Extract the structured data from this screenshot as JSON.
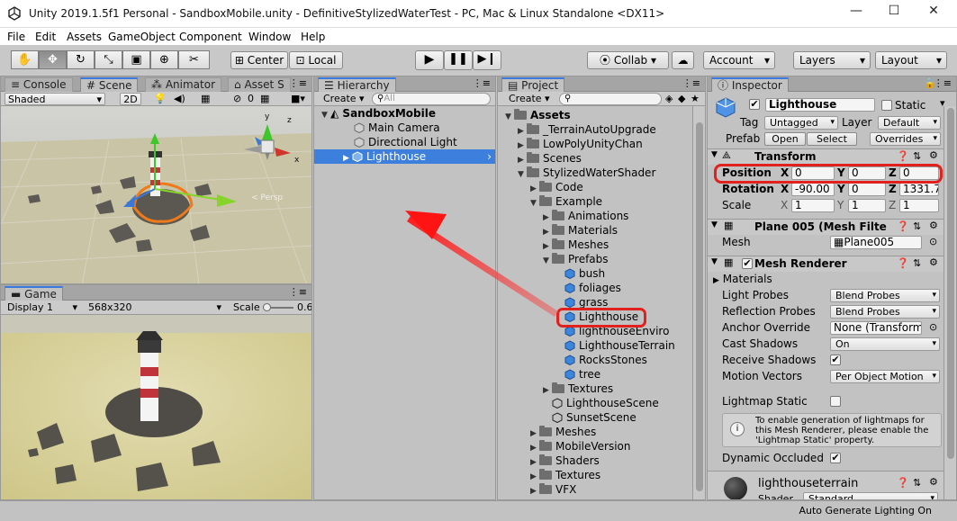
{
  "window": {
    "title": "Unity 2019.1.5f1 Personal - SandboxMobile.unity - DefinitiveStylizedWaterTest - PC, Mac & Linux Standalone <DX11>"
  },
  "menu": [
    "File",
    "Edit",
    "Assets",
    "GameObject",
    "Component",
    "Window",
    "Help"
  ],
  "toolbar": {
    "pivot": "Center",
    "space": "Local",
    "collab": "Collab ▾",
    "account": "Account",
    "layers": "Layers",
    "layout": "Layout"
  },
  "scene": {
    "tabs": [
      "Console",
      "Scene",
      "Animator",
      "Asset S"
    ],
    "shading": "Shaded",
    "mode2d": "2D",
    "hidden_count": "0",
    "gizmo_label": "< Persp"
  },
  "game": {
    "tab": "Game",
    "display": "Display 1",
    "resolution": "568x320",
    "scale_label": "Scale",
    "scale_value": "0.6"
  },
  "hierarchy": {
    "tab": "Hierarchy",
    "create": "Create ▾",
    "search_placeholder": "All",
    "scene": "SandboxMobile",
    "items": [
      "Main Camera",
      "Directional Light",
      "Lighthouse"
    ]
  },
  "project": {
    "tab": "Project",
    "create": "Create ▾",
    "tree": [
      {
        "label": "Assets",
        "depth": 0,
        "kind": "folder",
        "open": true,
        "bold": true
      },
      {
        "label": "_TerrainAutoUpgrade",
        "depth": 1,
        "kind": "folder"
      },
      {
        "label": "LowPolyUnityChan",
        "depth": 1,
        "kind": "folder"
      },
      {
        "label": "Scenes",
        "depth": 1,
        "kind": "folder"
      },
      {
        "label": "StylizedWaterShader",
        "depth": 1,
        "kind": "folder",
        "open": true
      },
      {
        "label": "Code",
        "depth": 2,
        "kind": "folder"
      },
      {
        "label": "Example",
        "depth": 2,
        "kind": "folder",
        "open": true
      },
      {
        "label": "Animations",
        "depth": 3,
        "kind": "folder"
      },
      {
        "label": "Materials",
        "depth": 3,
        "kind": "folder"
      },
      {
        "label": "Meshes",
        "depth": 3,
        "kind": "folder"
      },
      {
        "label": "Prefabs",
        "depth": 3,
        "kind": "folder",
        "open": true
      },
      {
        "label": "bush",
        "depth": 4,
        "kind": "prefab"
      },
      {
        "label": "foliages",
        "depth": 4,
        "kind": "prefab"
      },
      {
        "label": "grass",
        "depth": 4,
        "kind": "prefab"
      },
      {
        "label": "Lighthouse",
        "depth": 4,
        "kind": "prefab",
        "highlight": true
      },
      {
        "label": "lighthouseEnviro",
        "depth": 4,
        "kind": "prefab"
      },
      {
        "label": "LighthouseTerrain",
        "depth": 4,
        "kind": "prefab"
      },
      {
        "label": "RocksStones",
        "depth": 4,
        "kind": "prefab"
      },
      {
        "label": "tree",
        "depth": 4,
        "kind": "prefab"
      },
      {
        "label": "Textures",
        "depth": 3,
        "kind": "folder"
      },
      {
        "label": "LighthouseScene",
        "depth": 3,
        "kind": "scene"
      },
      {
        "label": "SunsetScene",
        "depth": 3,
        "kind": "scene"
      },
      {
        "label": "Meshes",
        "depth": 2,
        "kind": "folder"
      },
      {
        "label": "MobileVersion",
        "depth": 2,
        "kind": "folder"
      },
      {
        "label": "Shaders",
        "depth": 2,
        "kind": "folder"
      },
      {
        "label": "Textures",
        "depth": 2,
        "kind": "folder"
      },
      {
        "label": "VFX",
        "depth": 2,
        "kind": "folder"
      }
    ]
  },
  "inspector": {
    "tab": "Inspector",
    "object_name": "Lighthouse",
    "static_label": "Static",
    "tag_label": "Tag",
    "tag_value": "Untagged",
    "layer_label": "Layer",
    "layer_value": "Default",
    "prefab_label": "Prefab",
    "open": "Open",
    "select": "Select",
    "overrides": "Overrides",
    "transform": {
      "title": "Transform",
      "position_label": "Position",
      "rotation_label": "Rotation",
      "scale_label": "Scale",
      "position": [
        "0",
        "0",
        "0"
      ],
      "rotation": [
        "-90.00",
        "0",
        "1331.7"
      ],
      "scale": [
        "1",
        "1",
        "1"
      ],
      "axes": [
        "X",
        "Y",
        "Z"
      ]
    },
    "meshfilter": {
      "title": "Plane 005 (Mesh Filte",
      "mesh_label": "Mesh",
      "mesh_value": "Plane005"
    },
    "renderer": {
      "title": "Mesh Renderer",
      "materials": "Materials",
      "props": [
        {
          "label": "Light Probes",
          "value": "Blend Probes",
          "type": "dd"
        },
        {
          "label": "Reflection Probes",
          "value": "Blend Probes",
          "type": "dd"
        },
        {
          "label": "Anchor Override",
          "value": "None (Transform)",
          "type": "obj"
        },
        {
          "label": "Cast Shadows",
          "value": "On",
          "type": "dd"
        },
        {
          "label": "Receive Shadows",
          "value": "✔",
          "type": "chk"
        },
        {
          "label": "Motion Vectors",
          "value": "Per Object Motion",
          "type": "dd"
        }
      ],
      "lightmap_static": "Lightmap Static",
      "info": "To enable generation of lightmaps for this Mesh Renderer, please enable the 'Lightmap Static' property.",
      "dynamic_occluded": "Dynamic Occluded"
    },
    "material": {
      "name": "lighthouseterrain",
      "shader_label": "Shader",
      "shader_value": "Standard"
    }
  },
  "status": {
    "text": "Auto Generate Lighting On"
  },
  "colors": {
    "accent": "#3c7ae0",
    "highlight_red": "#e0211d",
    "selection": "#3d7fdd"
  }
}
